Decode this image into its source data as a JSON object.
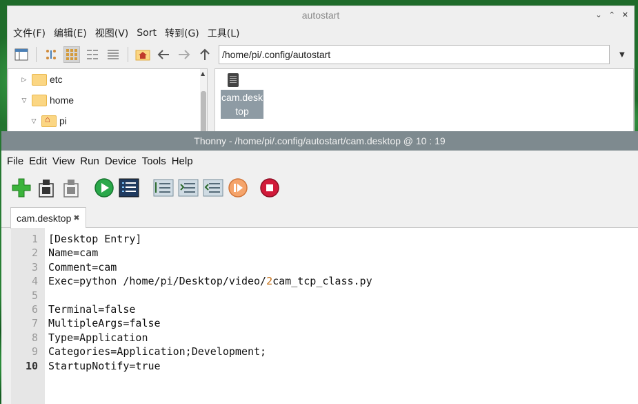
{
  "filemanager": {
    "title": "autostart",
    "menu": [
      "文件(F)",
      "编辑(E)",
      "视图(V)",
      "Sort",
      "转到(G)",
      "工具(L)"
    ],
    "address": "/home/pi/.config/autostart",
    "tree": [
      {
        "label": "etc",
        "arrow": "▷",
        "indent": 0
      },
      {
        "label": "home",
        "arrow": "▽",
        "indent": 0
      },
      {
        "label": "pi",
        "arrow": "▽",
        "indent": 1
      }
    ],
    "files": [
      {
        "label": "cam.desktop"
      }
    ]
  },
  "thonny": {
    "title": "Thonny  -  /home/pi/.config/autostart/cam.desktop  @  10 : 19",
    "menu": [
      "File",
      "Edit",
      "View",
      "Run",
      "Device",
      "Tools",
      "Help"
    ],
    "tab": {
      "label": "cam.desktop"
    },
    "current_line": 10,
    "lines": [
      {
        "n": "1",
        "pre": "[Desktop Entry]",
        "num": "",
        "post": ""
      },
      {
        "n": "2",
        "pre": "Name=cam",
        "num": "",
        "post": ""
      },
      {
        "n": "3",
        "pre": "Comment=cam",
        "num": "",
        "post": ""
      },
      {
        "n": "4",
        "pre": "Exec=python /home/pi/Desktop/video/",
        "num": "2",
        "post": "cam_tcp_class.py"
      },
      {
        "n": "5",
        "pre": "",
        "num": "",
        "post": ""
      },
      {
        "n": "6",
        "pre": "Terminal=false",
        "num": "",
        "post": ""
      },
      {
        "n": "7",
        "pre": "MultipleArgs=false",
        "num": "",
        "post": ""
      },
      {
        "n": "8",
        "pre": "Type=Application",
        "num": "",
        "post": ""
      },
      {
        "n": "9",
        "pre": "Categories=Application;Development;",
        "num": "",
        "post": ""
      },
      {
        "n": "10",
        "pre": "StartupNotify=true",
        "num": "",
        "post": ""
      }
    ]
  },
  "colors": {
    "thonny_title_bar": "#7e8a8f",
    "gutter": "#e6e6e6",
    "number_literal": "#c26a0f",
    "selection": "#8e9ba4"
  }
}
